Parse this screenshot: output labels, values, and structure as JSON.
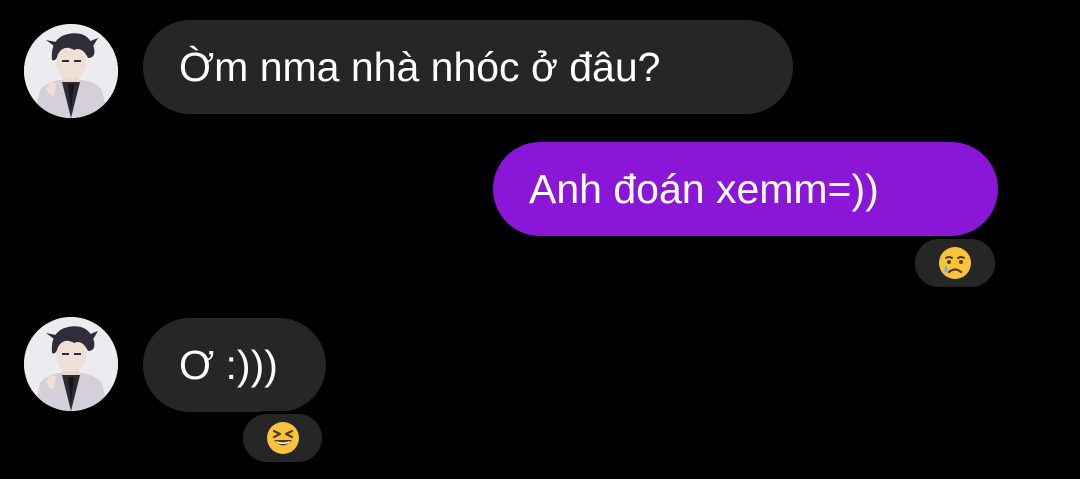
{
  "thread": {
    "messages": [
      {
        "sender": "other",
        "text": "Ờm nma nhà nhóc ở đâu?",
        "avatar_icon": "contact-avatar-icon"
      },
      {
        "sender": "me",
        "text": "Anh đoán xemm=))",
        "reaction": {
          "emoji": "😢",
          "icon": "crying-face-icon"
        }
      },
      {
        "sender": "other",
        "text": "Ơ :)))",
        "avatar_icon": "contact-avatar-icon",
        "reaction": {
          "emoji": "😆",
          "icon": "laughing-face-icon"
        }
      }
    ]
  },
  "colors": {
    "background": "#000000",
    "incoming_bubble": "#262626",
    "outgoing_bubble": "#8a17d8",
    "text": "#ffffff",
    "emoji_yellow": "#f7c33b"
  }
}
